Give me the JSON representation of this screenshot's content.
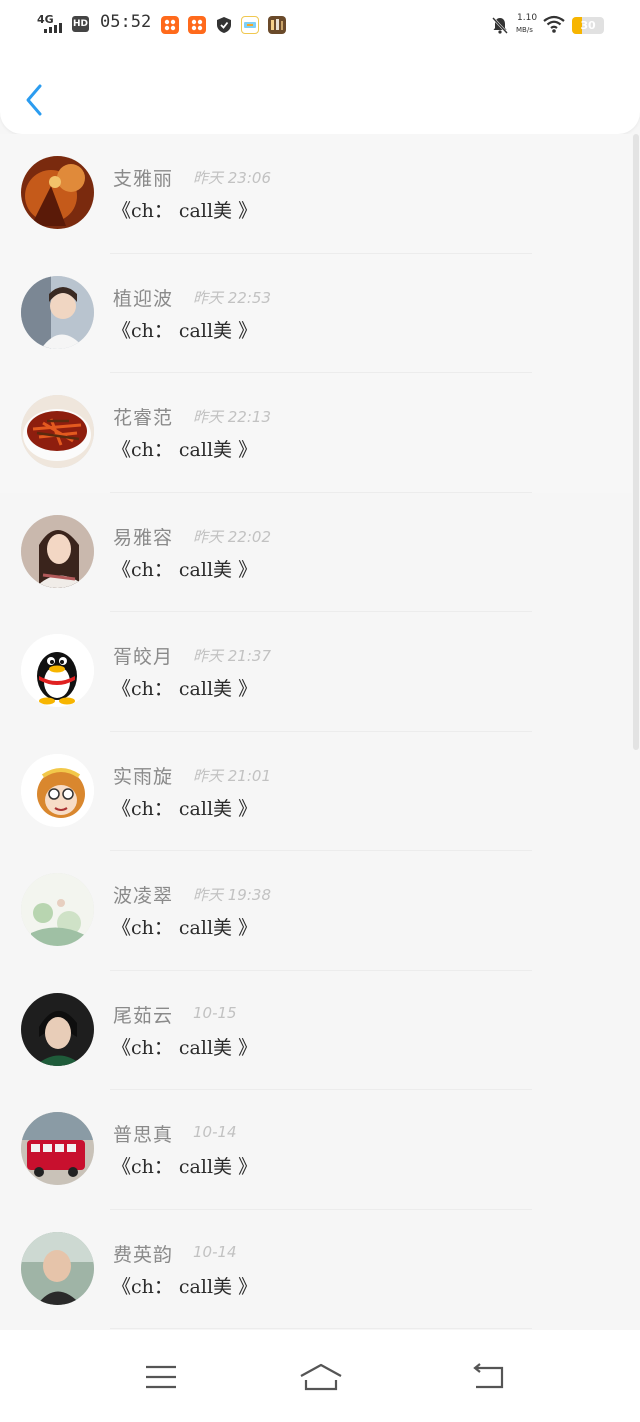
{
  "status_bar": {
    "network": "4G",
    "hd": "HD",
    "time": "05:52",
    "speed_value": "1.10",
    "speed_unit": "MB/s",
    "battery_level": "30",
    "battery_fraction": 0.3,
    "accent": "#f7b500"
  },
  "header": {
    "back_icon": "chevron-left-icon",
    "accent": "#2b9cf0"
  },
  "items": [
    {
      "name": "支雅丽",
      "time": "昨天 23:06",
      "message": "《ch： call美 》",
      "avatar": "warrior-art"
    },
    {
      "name": "植迎波",
      "time": "昨天 22:53",
      "message": "《ch： call美 》",
      "avatar": "girl-photo"
    },
    {
      "name": "花睿范",
      "time": "昨天 22:13",
      "message": "《ch： call美 》",
      "avatar": "food-dish"
    },
    {
      "name": "易雅容",
      "time": "昨天 22:02",
      "message": "《ch： call美 》",
      "avatar": "girl-portrait"
    },
    {
      "name": "胥皎月",
      "time": "昨天 21:37",
      "message": "《ch： call美 》",
      "avatar": "penguin"
    },
    {
      "name": "实雨旋",
      "time": "昨天 21:01",
      "message": "《ch： call美 》",
      "avatar": "monkey-cartoon"
    },
    {
      "name": "波凌翠",
      "time": "昨天 19:38",
      "message": "《ch： call美 》",
      "avatar": "watercolor"
    },
    {
      "name": "尾茹云",
      "time": "10-15",
      "message": "《ch： call美 》",
      "avatar": "man-portrait"
    },
    {
      "name": "普思真",
      "time": "10-14",
      "message": "《ch： call美 》",
      "avatar": "red-bus"
    },
    {
      "name": "费英韵",
      "time": "10-14",
      "message": "《ch： call美 》",
      "avatar": "man-photo"
    }
  ],
  "nav_bar": {
    "menu_icon": "menu-icon",
    "home_icon": "home-icon",
    "back_icon": "back-arrow-icon"
  }
}
